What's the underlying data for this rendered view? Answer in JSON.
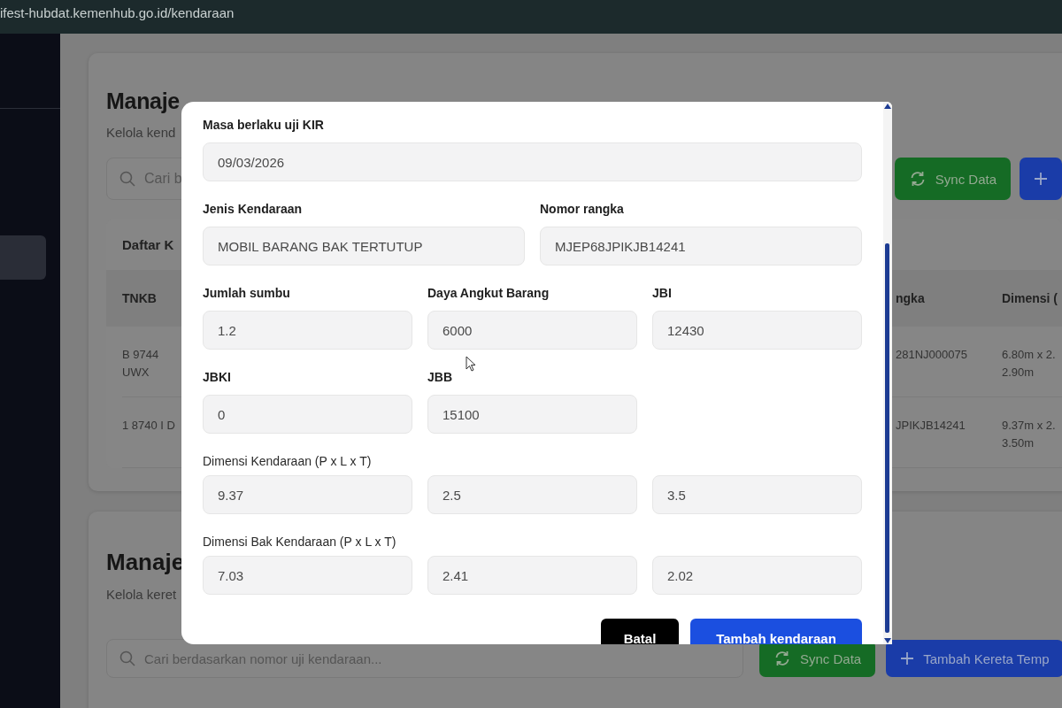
{
  "browser": {
    "url": "ifest-hubdat.kemenhub.go.id/kendaraan"
  },
  "sidebar": {
    "items": [
      {
        "selected": true
      }
    ]
  },
  "vehicle_section": {
    "title": "Manaje",
    "subtitle": "Kelola kend",
    "search": {
      "placeholder": "Cari b"
    },
    "buttons": [
      {
        "label": "Sync Data",
        "kind": "sync"
      },
      {
        "kind": "add"
      }
    ],
    "list_title": "Daftar K",
    "table": {
      "columns": [
        "TNKB",
        "ngka",
        "Dimensi ("
      ],
      "rows": [
        [
          "B 9744\nUWX",
          "281NJ000075",
          "6.80m x 2.\n2.90m"
        ],
        [
          "1 8740 I D",
          "JPIKJB14241",
          "9.37m x 2.\n3.50m"
        ]
      ]
    }
  },
  "trailer_section": {
    "title": "Manaje",
    "subtitle": "Kelola keret",
    "search": {
      "placeholder": "Cari berdasarkan nomor uji kendaraan..."
    },
    "buttons": [
      {
        "label": "Sync Data",
        "kind": "sync"
      },
      {
        "label": "Tambah Kereta Temp",
        "kind": "add"
      }
    ]
  },
  "modal": {
    "rows": [
      {
        "kind": "wide",
        "fields": [
          {
            "label": "Masa berlaku uji KIR",
            "value": "09/03/2026"
          }
        ]
      },
      {
        "kind": "pair",
        "fields": [
          {
            "label": "Jenis Kendaraan",
            "value": "MOBIL BARANG BAK TERTUTUP"
          },
          {
            "label": "Nomor rangka",
            "value": "MJEP68JPIKJB14241"
          }
        ]
      },
      {
        "kind": "trio",
        "fields": [
          {
            "label": "Jumlah sumbu",
            "value": "1.2"
          },
          {
            "label": "Daya Angkut Barang",
            "value": "6000"
          },
          {
            "label": "JBI",
            "value": "12430"
          }
        ]
      },
      {
        "kind": "trio",
        "fields": [
          {
            "label": "JBKI",
            "value": "0"
          },
          {
            "label": "JBB",
            "value": "15100"
          }
        ]
      },
      {
        "kind": "dimension",
        "label": "Dimensi Kendaraan (P x L x T)",
        "values": [
          "9.37",
          "2.5",
          "3.5"
        ]
      },
      {
        "kind": "dimension",
        "label": "Dimensi Bak Kendaraan (P x L x T)",
        "values": [
          "7.03",
          "2.41",
          "2.02"
        ]
      }
    ],
    "buttons": [
      {
        "label": "Batal",
        "kind": "cancel"
      },
      {
        "label": "Tambah kendaraan",
        "kind": "primary"
      }
    ]
  }
}
